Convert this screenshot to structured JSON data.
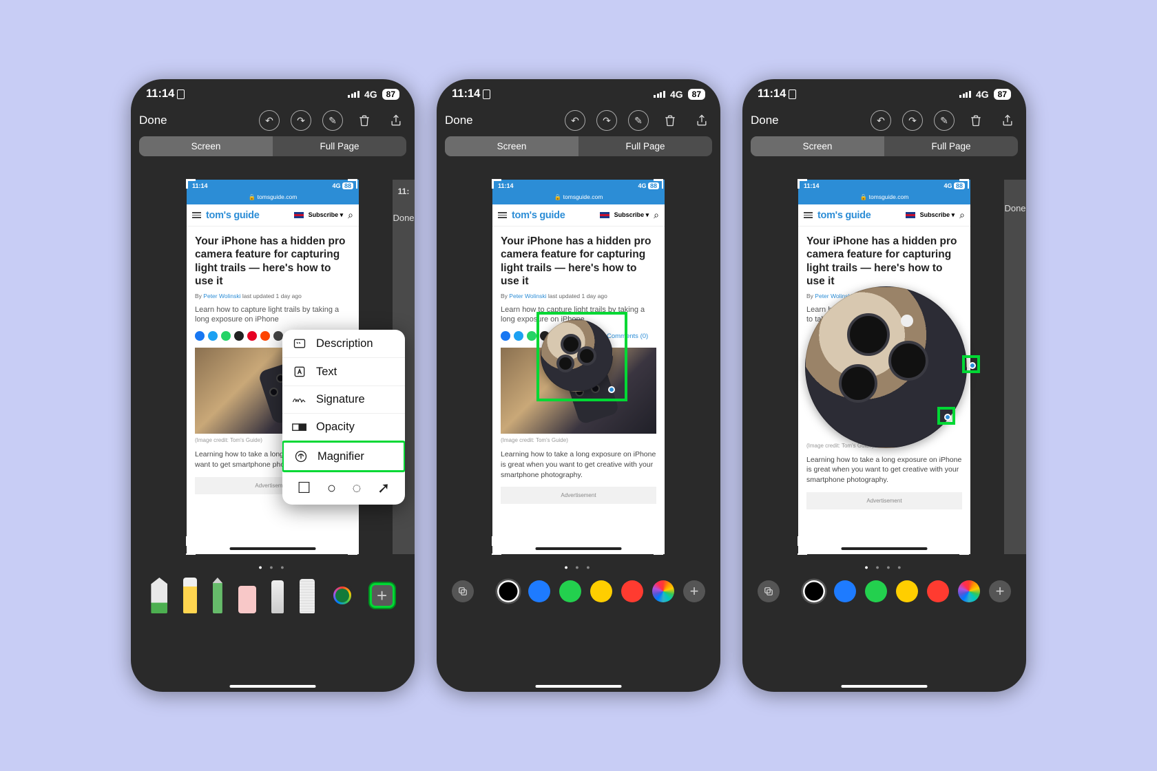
{
  "status": {
    "time": "11:14",
    "net": "4G",
    "battery": "87"
  },
  "editor": {
    "done": "Done",
    "tabs": {
      "screen": "Screen",
      "fullpage": "Full Page"
    },
    "peek_done": "Done",
    "peek_time": "11:"
  },
  "mini": {
    "time": "11:14",
    "net": "4G",
    "batt": "88",
    "url": "tomsguide.com",
    "logo": "tom's guide",
    "subscribe": "Subscribe ▾",
    "headline": "Your iPhone has a hidden pro camera feature for capturing light trails — here's how to use it",
    "by": "By",
    "author": "Peter Wolinski",
    "updated": "last updated 1 day ago",
    "lede": "Learn how to capture light trails by taking a long exposure on iPhone",
    "comments": "Comments (0)",
    "credit": "(Image credit: Tom's Guide)",
    "para_full": "Learning how to take a long exposure on iPhone is great when you want to get creative with your smartphone photography.",
    "para_cut": "Learning how to take a long e great when you want to get smartphone photography.",
    "para_short": "Learn how to taking a long exposure on",
    "ad": "Advertisement"
  },
  "popup": {
    "items": [
      "Description",
      "Text",
      "Signature",
      "Opacity",
      "Magnifier"
    ]
  },
  "social_colors": [
    "#1877f2",
    "#1da1f2",
    "#25d366",
    "#222",
    "#e60023",
    "#ff4500",
    "#444",
    "#2c8dd6"
  ],
  "palette_colors": [
    "#000",
    "#1e7bff",
    "#23d04e",
    "#ffce00",
    "#ff3b30"
  ]
}
